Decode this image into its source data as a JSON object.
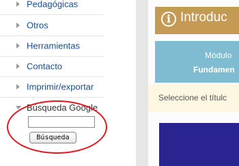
{
  "sidebar": {
    "items": [
      {
        "label": "Pedagógicas"
      },
      {
        "label": "Otros"
      },
      {
        "label": "Herramientas"
      },
      {
        "label": "Contacto"
      },
      {
        "label": "Imprimir/exportar"
      }
    ],
    "search": {
      "title": "Búsqueda Google",
      "input_value": "",
      "button_label": "Búsqueda"
    }
  },
  "main": {
    "intro_title": "Introduc",
    "info_icon_glyph": "i",
    "module_line1": "Módulo",
    "module_line2": "Fundamen",
    "instruction": "Seleccione el títulc"
  },
  "colors": {
    "link": "#1a4e8c",
    "header_gold": "#c49a55",
    "module_blue": "#7fbbd1",
    "dark_panel": "#29248f",
    "highlight_red": "#e8141b"
  }
}
